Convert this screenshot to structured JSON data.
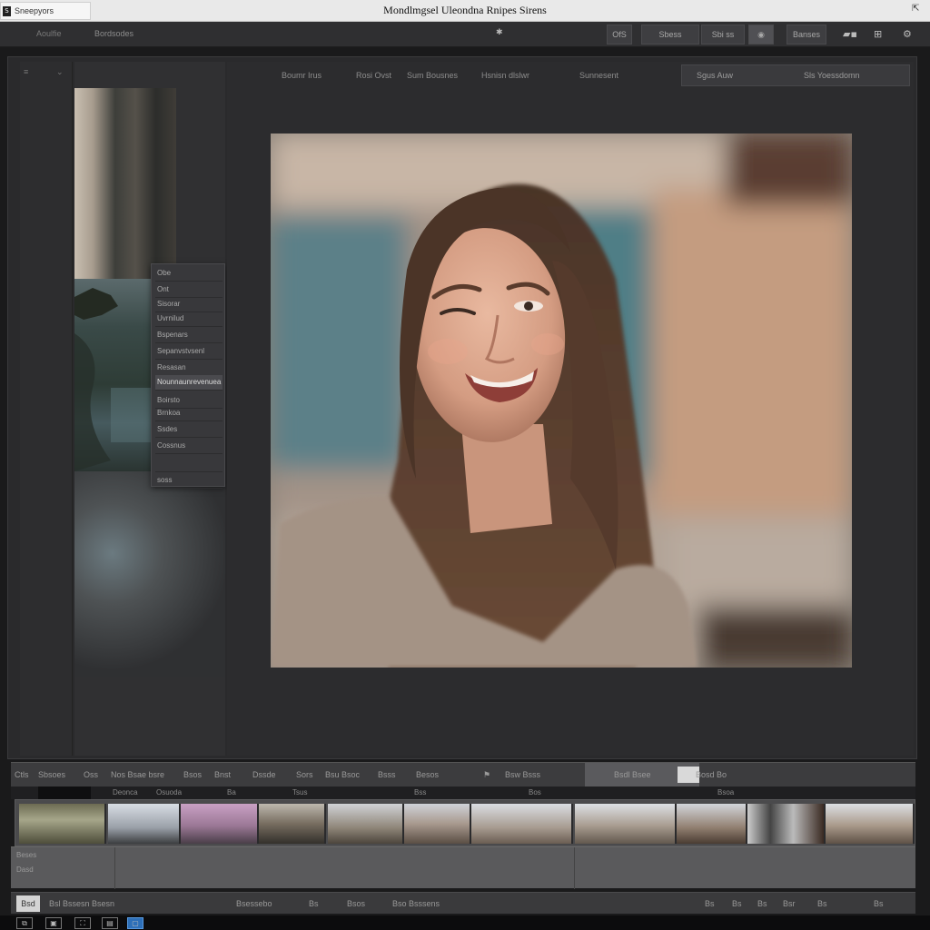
{
  "titlebar": {
    "tab_label": "Sneepyors",
    "app_icon": "S",
    "title": "Mondlmgsel Uleondna Rnipes Sirens",
    "pin_icon": "pin-icon"
  },
  "toolbar": {
    "left_text": "Aoulfie",
    "second_text": "Bordsodes",
    "center_icon": "✱",
    "btn1": "OfS",
    "btn2": "Sbess",
    "btn3": "Sbi ss",
    "btn4": "Banses",
    "right_icons": [
      "toggle-icon",
      "grid-icon",
      "settings-icon"
    ]
  },
  "left_col": {
    "icon1": "≡",
    "icon2": "⌄"
  },
  "menu": {
    "items": [
      "Obe",
      "Ont",
      "Sisorar",
      "Uvrnilud",
      "Bspenars",
      "Sepanvstvsenl",
      "Resasan",
      "Nounnaunrevenuea",
      "Boirsto",
      "Brnkoa",
      "Ssdes",
      "Cossnus",
      "",
      "soss"
    ],
    "selected_index": 7
  },
  "preview_bar": {
    "labels": [
      "Boumr Irus",
      "Rosi Ovst",
      "Sum Bousnes",
      "Hsnisn dlslwr",
      "Sunnesent"
    ],
    "search_left": "Sgus Auw",
    "search_right": "Sls Yoessdomn"
  },
  "photo": {
    "alt": "portrait"
  },
  "film_header": {
    "labels": [
      "Ctls",
      "Sbsoes",
      "Oss",
      "Nos Bsae bsre",
      "Bsos",
      "Bnst",
      "Dssde",
      "Sors",
      "Bsu Bsoc",
      "Bsss",
      "Besos",
      "Bsw Bsss",
      "Bsdl Bsee",
      "Bosd Bo"
    ],
    "icon": "⚑"
  },
  "film_sub": {
    "labels": [
      "Deonca",
      "Osuoda",
      "Ba",
      "Tsus",
      "Bss",
      "Bos",
      "Bsoa"
    ]
  },
  "filmstrip": {
    "count": 12
  },
  "film_lower": {
    "row1": "Beses",
    "row2": "Dasd"
  },
  "bottom_bar": {
    "square": "Bsd",
    "left": "Bsl Bssesn Bsesn",
    "mid1": "Bsessebo",
    "mid2": "Bs",
    "mid3": "Bsos",
    "mid4": "Bso Bsssens",
    "right": [
      "Bs",
      "Bs",
      "Bs",
      "Bsr",
      "Bs",
      "Bs"
    ]
  },
  "taskbar": {
    "items": [
      "⧉",
      "▣",
      "⛶",
      "▤",
      "▢"
    ]
  }
}
